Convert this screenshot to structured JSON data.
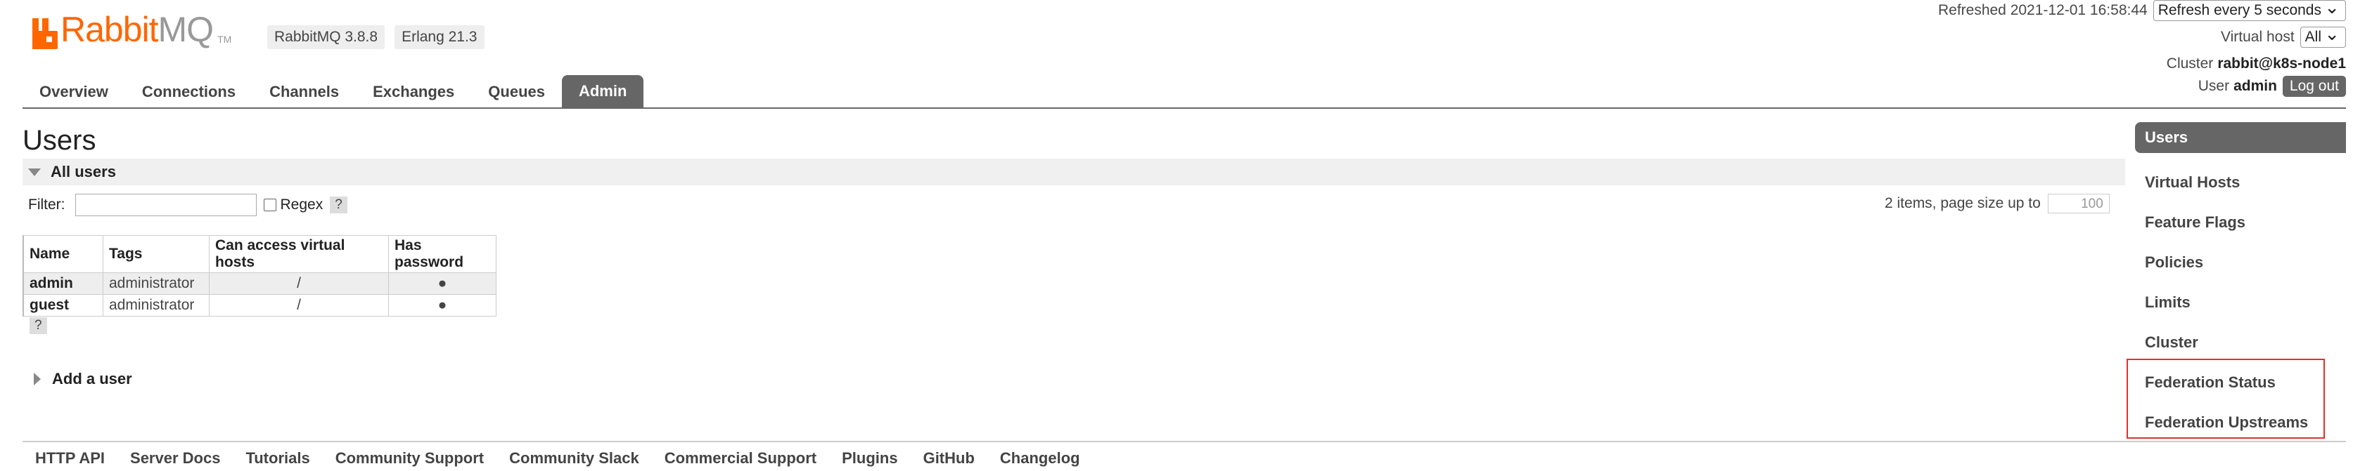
{
  "brand": {
    "logo_rabbit": "Rabbit",
    "logo_mq": "MQ",
    "logo_tm": "TM",
    "accent": "#ff6600"
  },
  "versions": [
    "RabbitMQ 3.8.8",
    "Erlang 21.3"
  ],
  "status": {
    "refreshed_label": "Refreshed 2021-12-01 16:58:44",
    "refresh_select": "Refresh every 5 seconds",
    "vhost_label": "Virtual host",
    "vhost_select": "All",
    "cluster_label": "Cluster",
    "cluster_name": "rabbit@k8s-node1",
    "user_label": "User",
    "user_name": "admin",
    "logout": "Log out"
  },
  "tabs": [
    {
      "label": "Overview"
    },
    {
      "label": "Connections"
    },
    {
      "label": "Channels"
    },
    {
      "label": "Exchanges"
    },
    {
      "label": "Queues"
    },
    {
      "label": "Admin",
      "active": true
    }
  ],
  "page": {
    "title": "Users",
    "section_all_users": "All users",
    "filter_label": "Filter:",
    "regex_label": "Regex",
    "help": "?",
    "paging_text": "2 items, page size up to",
    "page_size": "100",
    "add_user": "Add a user"
  },
  "users_table": {
    "headers": [
      "Name",
      "Tags",
      "Can access virtual hosts",
      "Has password"
    ],
    "rows": [
      [
        "admin",
        "administrator",
        "/",
        "●"
      ],
      [
        "guest",
        "administrator",
        "/",
        "●"
      ]
    ]
  },
  "sidebar": [
    {
      "label": "Users",
      "active": true
    },
    {
      "label": "Virtual Hosts"
    },
    {
      "label": "Feature Flags"
    },
    {
      "label": "Policies"
    },
    {
      "label": "Limits"
    },
    {
      "label": "Cluster"
    },
    {
      "label": "Federation Status"
    },
    {
      "label": "Federation Upstreams"
    }
  ],
  "footer": [
    "HTTP API",
    "Server Docs",
    "Tutorials",
    "Community Support",
    "Community Slack",
    "Commercial Support",
    "Plugins",
    "GitHub",
    "Changelog"
  ]
}
